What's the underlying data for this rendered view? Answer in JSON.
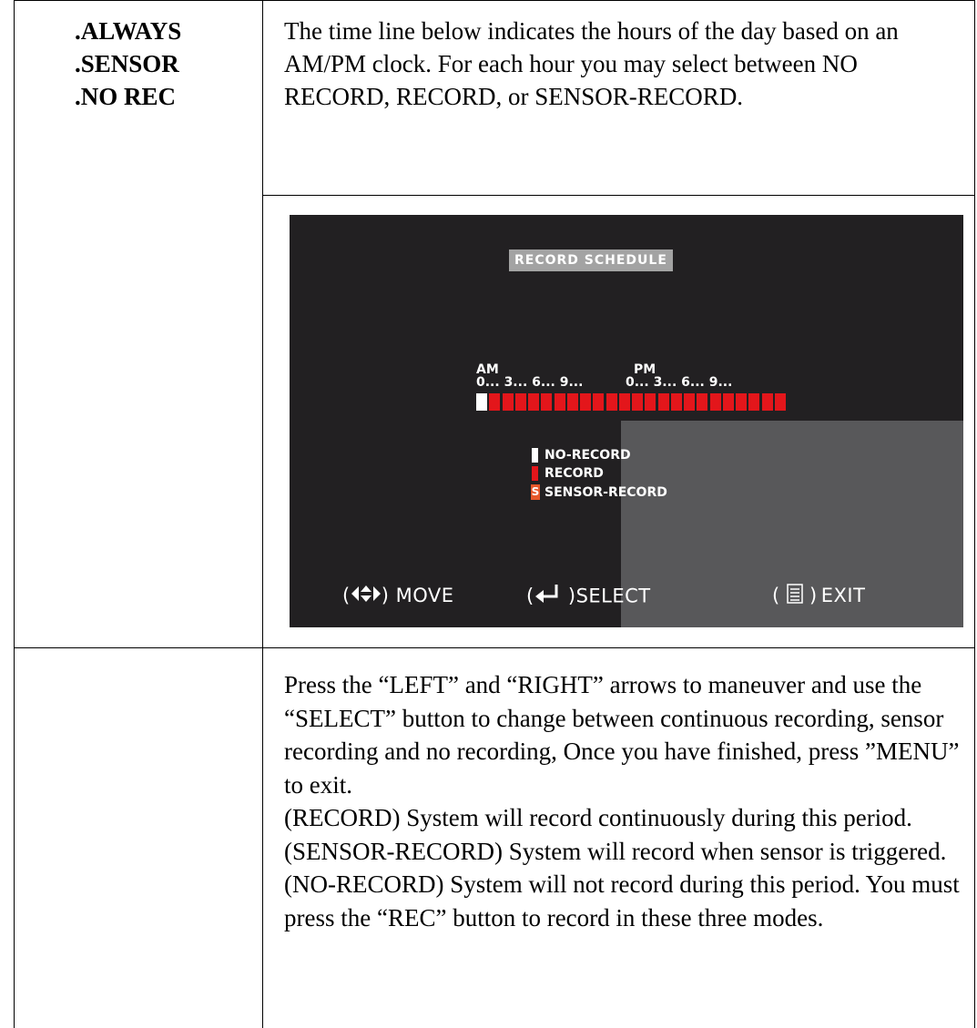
{
  "options": [
    ".ALWAYS",
    ".SENSOR",
    ".NO REC"
  ],
  "intro_text": "The time line below indicates the hours of the day based on an AM/PM clock. For each hour you may select between NO RECORD, RECORD, or SENSOR-RECORD.",
  "screen": {
    "title": "RECORD SCHEDULE",
    "am_label": "AM",
    "pm_label": "PM",
    "hour_ticks_am": "0... 3... 6... 9...",
    "hour_ticks_pm": "0... 3... 6... 9...",
    "schedule": [
      "no-record",
      "record",
      "record",
      "record",
      "record",
      "record",
      "record",
      "record",
      "record",
      "record",
      "record",
      "record",
      "record",
      "record",
      "record",
      "record",
      "record",
      "record",
      "record",
      "record",
      "record",
      "record",
      "record",
      "record"
    ],
    "legend": {
      "no_record": "NO-RECORD",
      "record": "RECORD",
      "sensor_symbol": "S",
      "sensor_record": "SENSOR-RECORD"
    },
    "footer": {
      "move": "MOVE",
      "select": "SELECT",
      "exit": "EXIT"
    },
    "colors": {
      "record": "#e3161b",
      "no_record": "#ffffff",
      "sensor": "#e6582a",
      "background": "#222022",
      "title_bg": "#a3a3a3"
    }
  },
  "instructions": [
    "Press the “LEFT” and “RIGHT” arrows to maneuver and use the “SELECT” button to change between continuous recording, sensor recording and no recording, Once you have finished, press ”MENU” to exit.",
    "(RECORD) System will record continuously during this period. (SENSOR-RECORD) System will record when sensor is triggered.",
    "(NO-RECORD) System will not record during this period. You must press the “REC” button to record in these three modes."
  ]
}
